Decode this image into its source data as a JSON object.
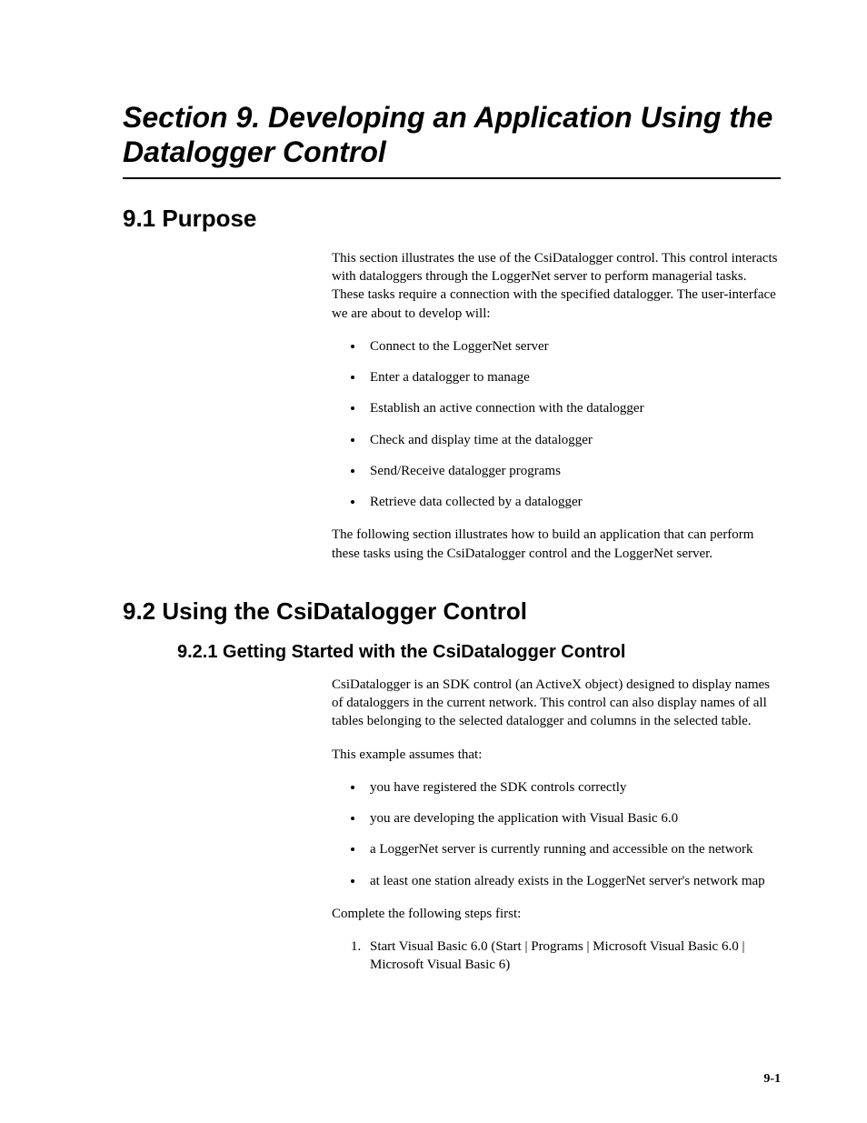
{
  "title": "Section 9.  Developing an Application Using the Datalogger Control",
  "s91": {
    "heading": "9.1  Purpose",
    "intro": "This section illustrates the use of the CsiDatalogger control.  This control interacts with dataloggers through the LoggerNet server to perform managerial tasks.  These tasks require a connection with the specified datalogger.  The user-interface we are about to develop will:",
    "bullets": [
      "Connect to the LoggerNet server",
      "Enter a datalogger to manage",
      "Establish an active connection with the datalogger",
      "Check and display time at the datalogger",
      "Send/Receive datalogger programs",
      "Retrieve data collected by a datalogger"
    ],
    "outro": "The following section illustrates how to build an application that can perform these tasks using the CsiDatalogger control and the LoggerNet server."
  },
  "s92": {
    "heading": "9.2  Using the CsiDatalogger Control",
    "s921": {
      "heading": "9.2.1  Getting Started with the CsiDatalogger Control",
      "p1": "CsiDatalogger is an SDK control (an ActiveX object) designed to display names of dataloggers in the current network.  This control can also display names of all tables belonging to the selected datalogger and columns in the selected table.",
      "p2": "This example assumes that:",
      "assumptions": [
        "you have registered the SDK controls correctly",
        "you are developing the application with Visual Basic 6.0",
        "a LoggerNet server is currently running and accessible on the network",
        "at least one station already exists in the LoggerNet server's network map"
      ],
      "p3": "Complete the following steps first:",
      "steps": [
        "Start Visual Basic 6.0 (Start | Programs | Microsoft Visual Basic 6.0 | Microsoft Visual Basic 6)"
      ]
    }
  },
  "page_number": "9-1"
}
